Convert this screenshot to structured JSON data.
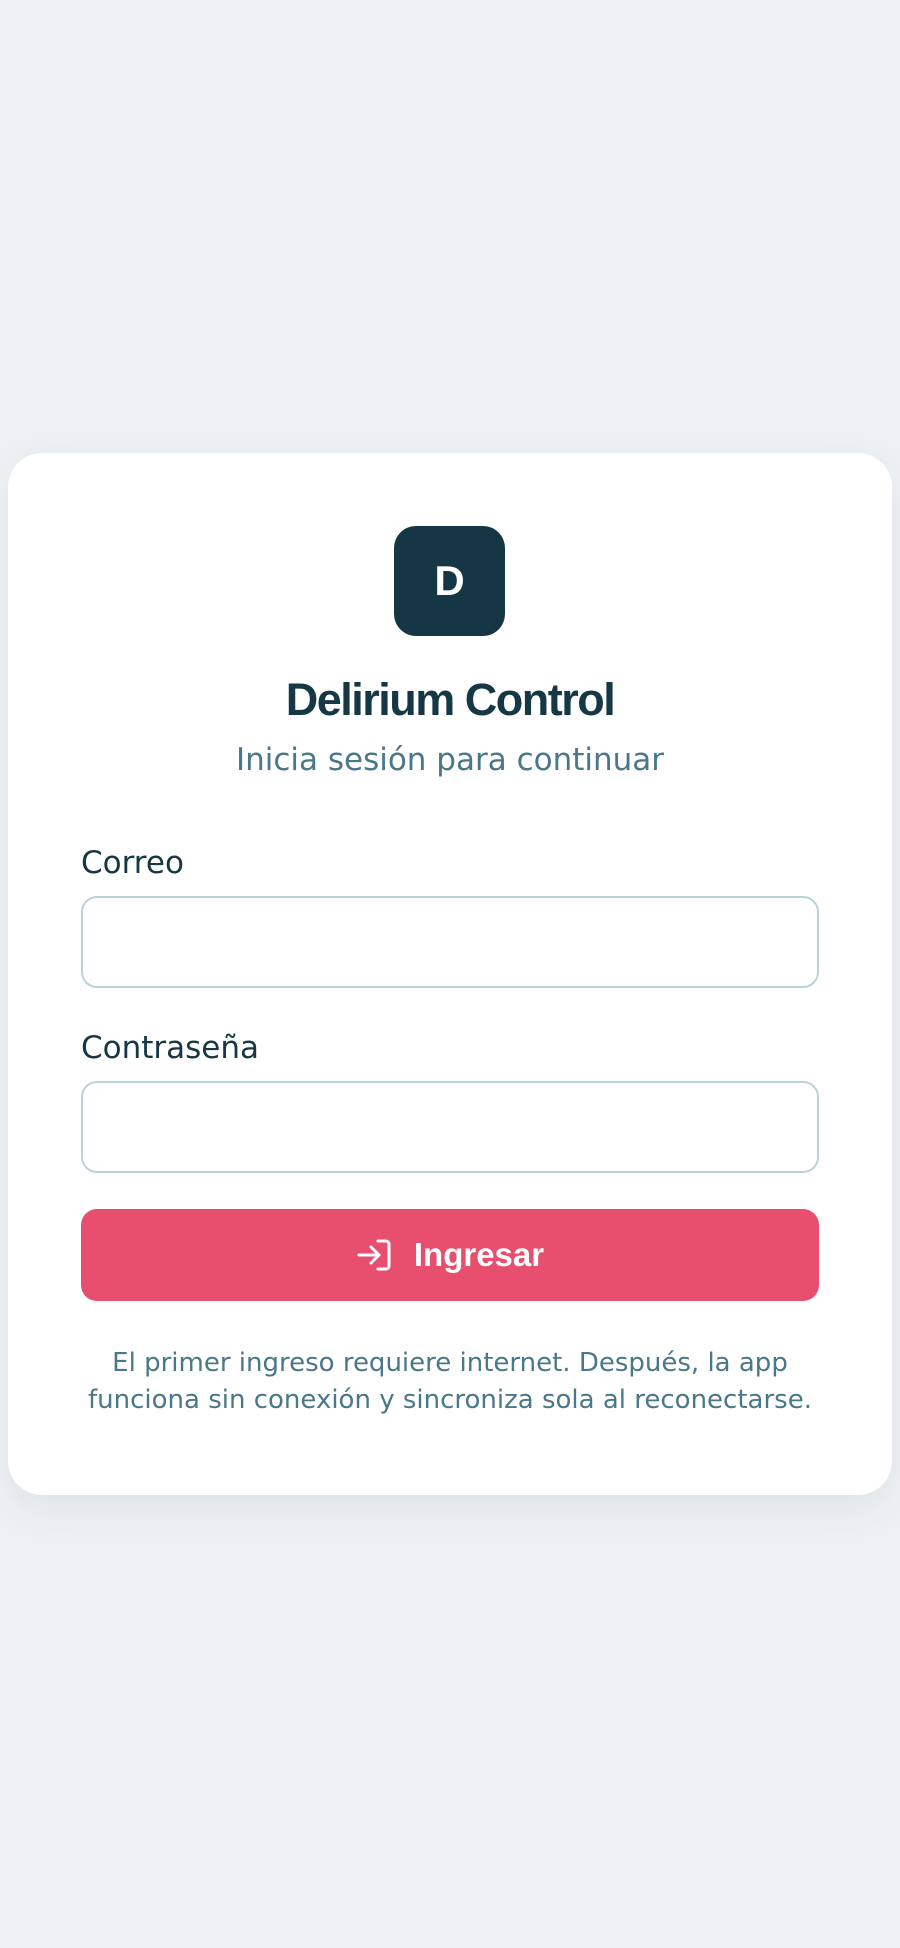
{
  "app": {
    "logo_letter": "D",
    "title": "Delirium Control",
    "subtitle": "Inicia sesión para continuar"
  },
  "form": {
    "email_label": "Correo",
    "email_value": "",
    "password_label": "Contraseña",
    "password_value": "",
    "submit_label": "Ingresar",
    "submit_icon": "login-icon"
  },
  "footer": {
    "note": "El primer ingreso requiere internet. Después, la app funciona sin conexión y sincroniza sola al reconectarse."
  },
  "colors": {
    "background": "#eef1f4",
    "card": "#ffffff",
    "brand_dark": "#153745",
    "accent": "#e84f6e",
    "muted_text": "#4a7888",
    "input_border": "#b9d3da"
  }
}
